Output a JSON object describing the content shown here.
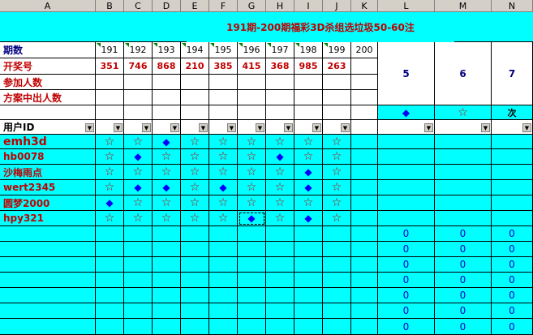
{
  "columns": [
    "A",
    "B",
    "C",
    "D",
    "E",
    "F",
    "G",
    "H",
    "I",
    "J",
    "K",
    "L",
    "M",
    "N"
  ],
  "title": "191期-200期福彩3D杀组选垃圾50-60注",
  "row_labels": {
    "periods": "期数",
    "numbers": "开奖号",
    "participants": "参加人数",
    "hits": "方案中出人数",
    "userid": "用户ID"
  },
  "periods": [
    "191",
    "192",
    "193",
    "194",
    "195",
    "196",
    "197",
    "198",
    "199",
    "200"
  ],
  "draw_numbers": [
    "351",
    "746",
    "868",
    "210",
    "385",
    "415",
    "368",
    "985",
    "263",
    ""
  ],
  "right_headers": [
    "5",
    "6",
    "7"
  ],
  "right_marks": [
    "◆",
    "☆",
    "次"
  ],
  "users": [
    {
      "id": "emh3d",
      "marks": [
        "star",
        "star",
        "dia",
        "star",
        "star",
        "star",
        "star",
        "star",
        "star",
        ""
      ]
    },
    {
      "id": "hb0078",
      "marks": [
        "star",
        "dia",
        "star",
        "star",
        "star",
        "star",
        "dia",
        "star",
        "star",
        ""
      ]
    },
    {
      "id": "沙梅雨点",
      "marks": [
        "star",
        "star",
        "star",
        "star",
        "star",
        "star",
        "star",
        "dia",
        "star",
        ""
      ]
    },
    {
      "id": "wert2345",
      "marks": [
        "star",
        "dia",
        "dia",
        "star",
        "dia",
        "star",
        "star",
        "dia",
        "star",
        ""
      ]
    },
    {
      "id": "圆梦2000",
      "marks": [
        "dia",
        "star",
        "star",
        "star",
        "star",
        "star",
        "star",
        "star",
        "star",
        ""
      ]
    },
    {
      "id": "hpy321",
      "marks": [
        "star",
        "star",
        "star",
        "star",
        "star",
        "dia",
        "star",
        "dia",
        "star",
        ""
      ]
    }
  ],
  "zero_value": "0",
  "colors": {
    "star": "#c00000",
    "diamond": "#0000ff",
    "bg": "#00ffff"
  }
}
